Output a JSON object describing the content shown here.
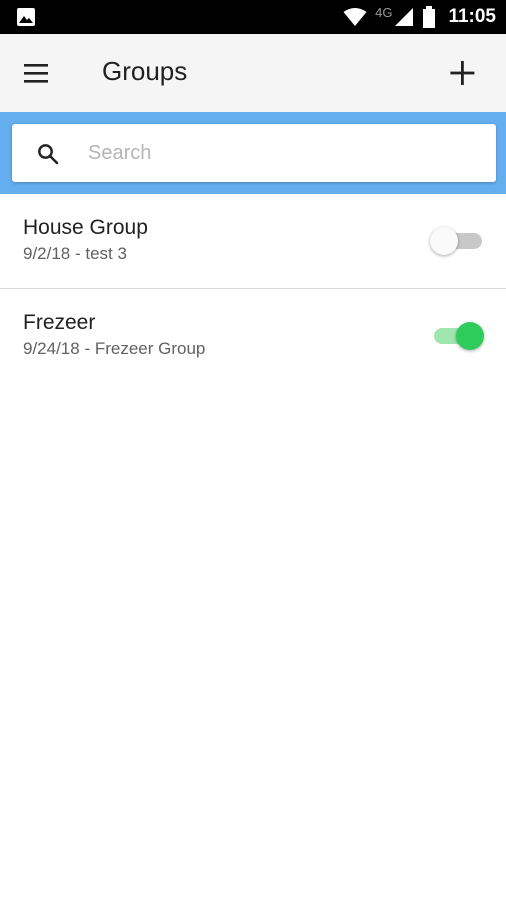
{
  "status_bar": {
    "network_type": "4G",
    "time": "11:05",
    "icons": [
      "image-notification-icon",
      "wifi-icon",
      "cell-signal-icon",
      "battery-icon"
    ]
  },
  "app_bar": {
    "title": "Groups",
    "menu_icon": "menu-icon",
    "add_icon": "add-icon"
  },
  "search": {
    "placeholder": "Search",
    "value": ""
  },
  "colors": {
    "search_band": "#64aef0",
    "toggle_on": "#2ecc5b",
    "toggle_on_track": "#9fe6b1",
    "status_bar": "#000000",
    "app_bar": "#f5f5f5"
  },
  "groups": [
    {
      "title": "House Group",
      "subtitle": "9/2/18 - test 3",
      "enabled": false
    },
    {
      "title": "Frezeer",
      "subtitle": "9/24/18 - Frezeer Group",
      "enabled": true
    }
  ]
}
